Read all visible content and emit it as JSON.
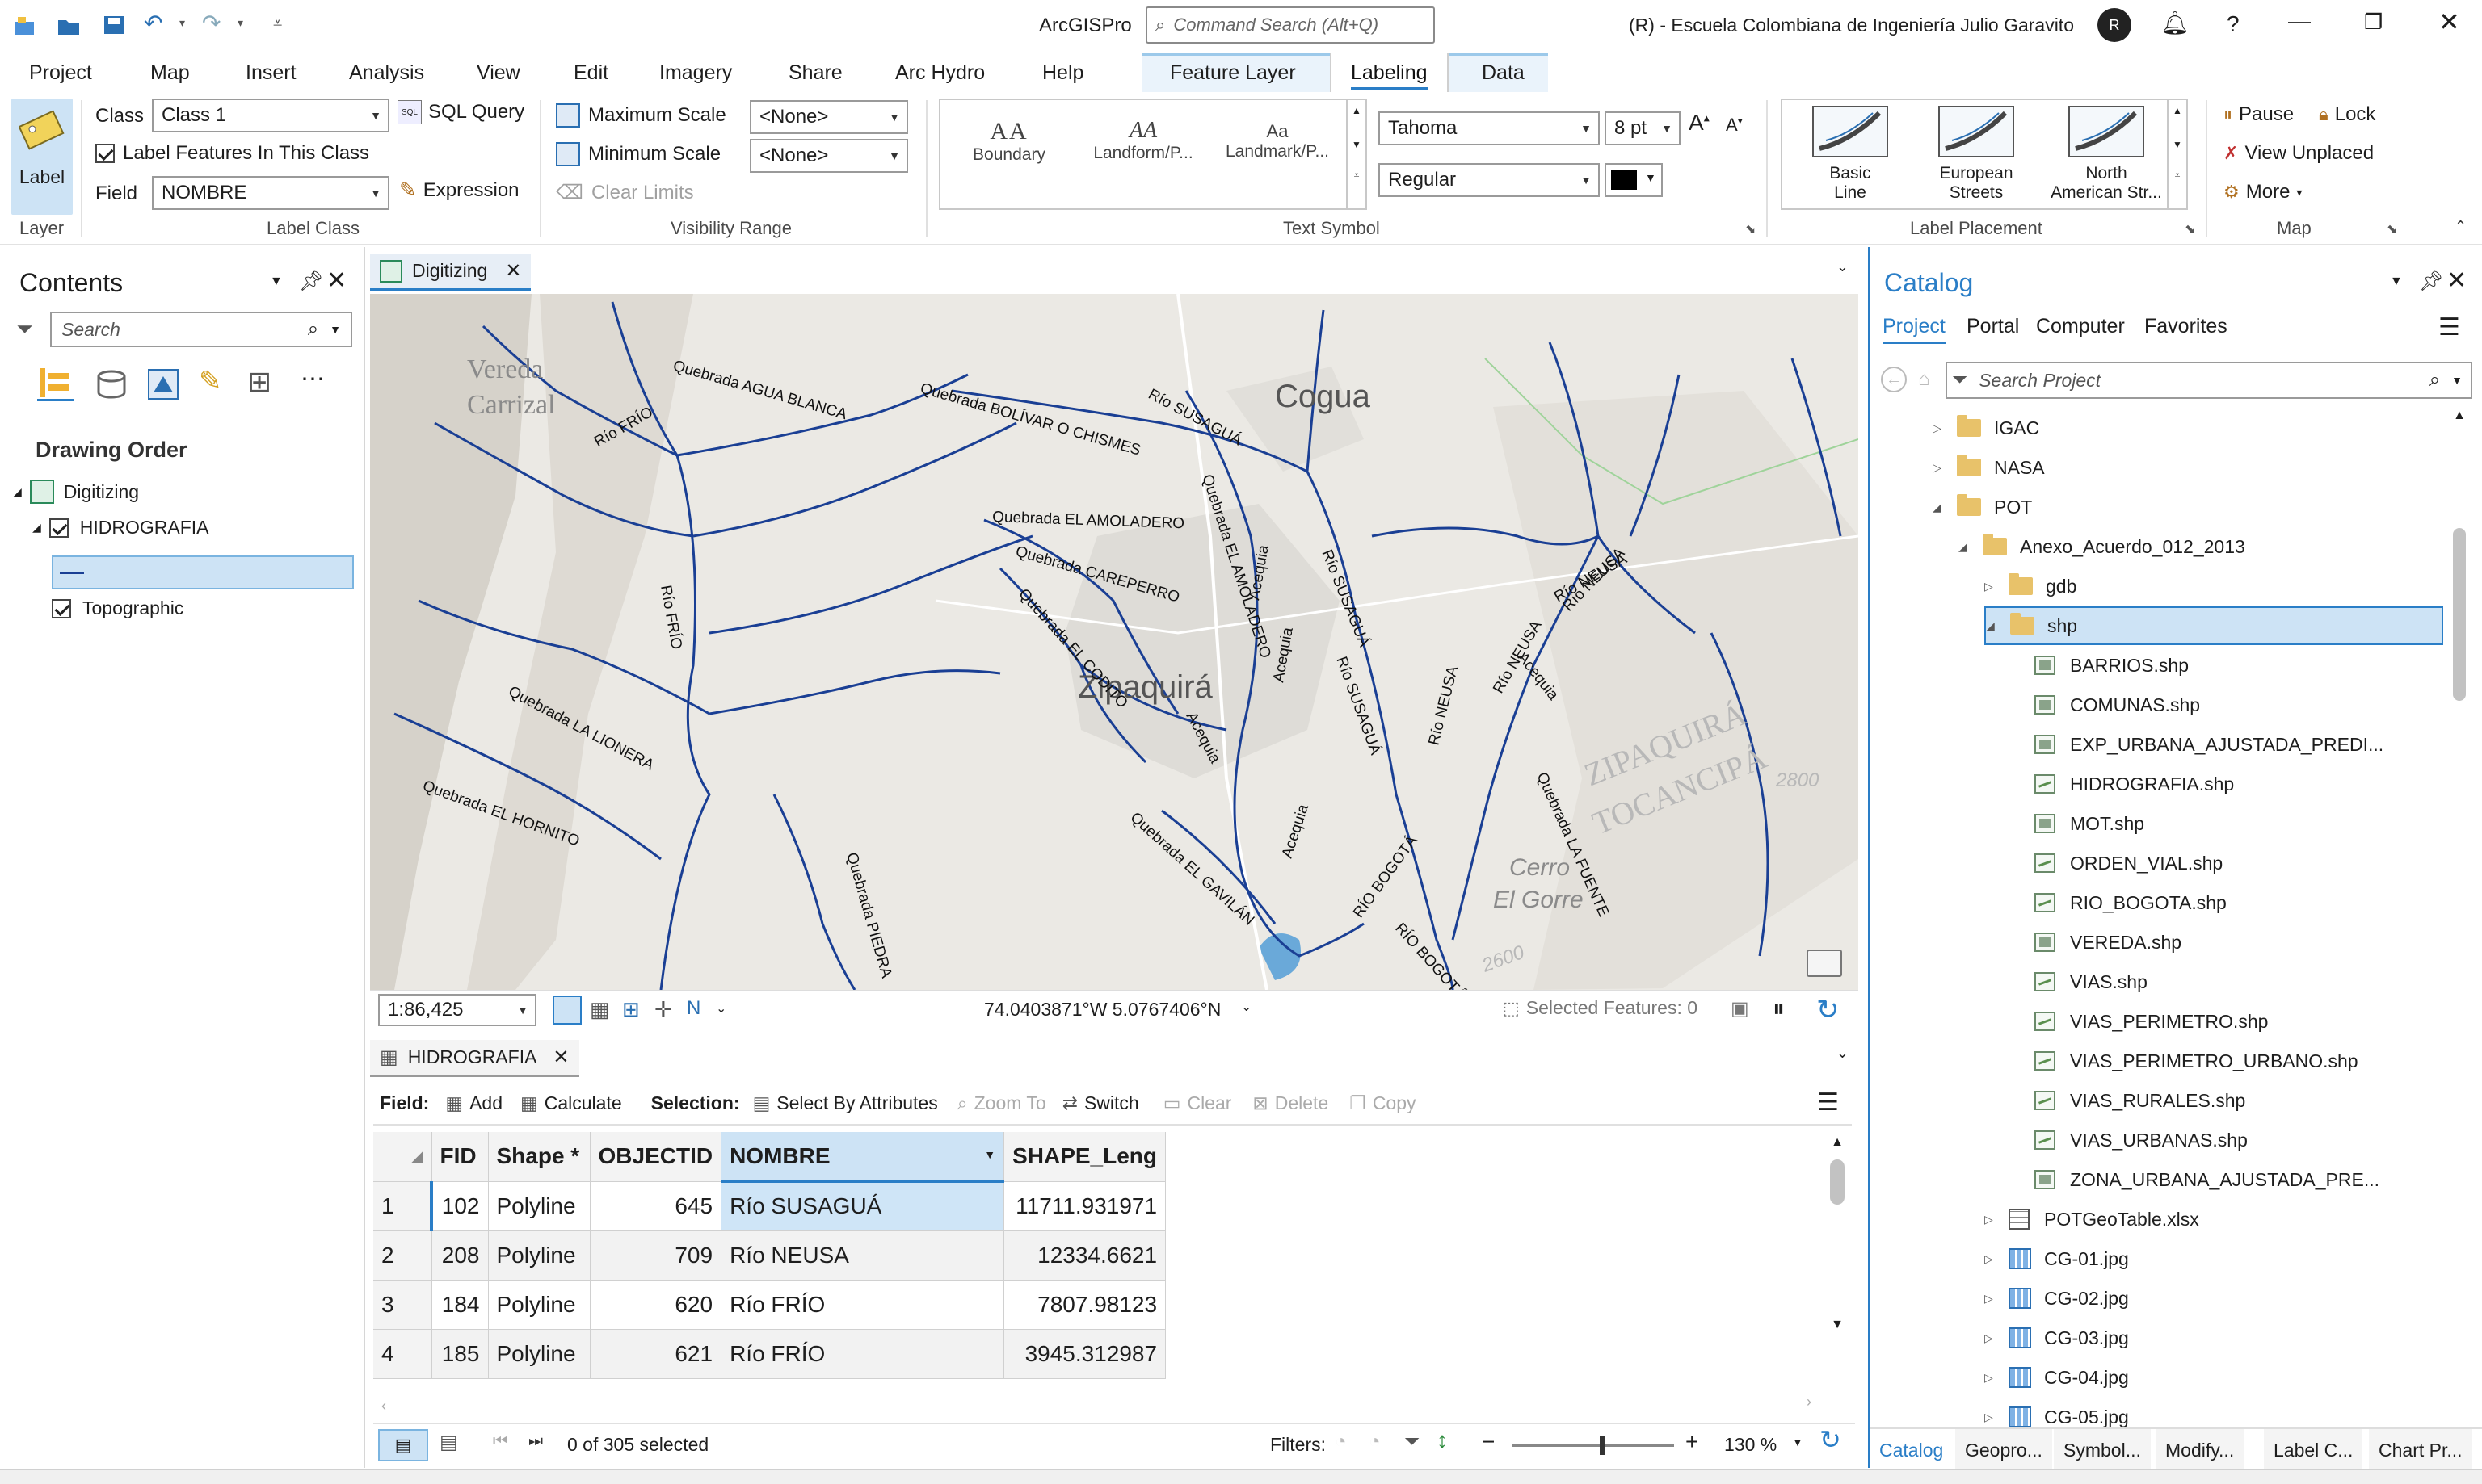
{
  "app": {
    "title": "ArcGISPro",
    "command_search_placeholder": "Command Search (Alt+Q)",
    "user_org": "(R) - Escuela Colombiana de Ingeniería Julio Garavito",
    "user_initial": "R"
  },
  "menu": {
    "tabs": [
      "Project",
      "Map",
      "Insert",
      "Analysis",
      "View",
      "Edit",
      "Imagery",
      "Share",
      "Arc Hydro",
      "Help"
    ],
    "context_tabs": [
      "Feature Layer",
      "Labeling",
      "Data"
    ],
    "active_context_tab": "Labeling"
  },
  "ribbon": {
    "layer_group": {
      "button": "Label",
      "label": "Layer"
    },
    "label_class": {
      "class_label": "Class",
      "class_value": "Class 1",
      "sql_query": "SQL Query",
      "label_features": "Label Features In This Class",
      "field_label": "Field",
      "field_value": "NOMBRE",
      "expression": "Expression",
      "group_label": "Label Class"
    },
    "visibility": {
      "max_scale": "Maximum Scale",
      "max_value": "<None>",
      "min_scale": "Minimum Scale",
      "min_value": "<None>",
      "clear_limits": "Clear Limits",
      "group_label": "Visibility Range"
    },
    "text_symbol": {
      "gallery": [
        {
          "preview": "AA",
          "label": "Boundary"
        },
        {
          "preview": "AA",
          "label": "Landform/P..."
        },
        {
          "preview": "Aa",
          "label": "Landmark/P..."
        }
      ],
      "font": "Tahoma",
      "size": "8 pt",
      "style": "Regular",
      "grow": "A",
      "shrink": "A",
      "color": "#000000",
      "group_label": "Text Symbol"
    },
    "placement": {
      "items": [
        {
          "line1": "Basic",
          "line2": "Line"
        },
        {
          "line1": "European",
          "line2": "Streets"
        },
        {
          "line1": "North",
          "line2": "American Str..."
        }
      ],
      "group_label": "Label Placement"
    },
    "map_group": {
      "pause": "Pause",
      "lock": "Lock",
      "view_unplaced": "View Unplaced",
      "more": "More",
      "group_label": "Map"
    }
  },
  "contents": {
    "title": "Contents",
    "search_placeholder": "Search",
    "drawing_order": "Drawing Order",
    "map_name": "Digitizing",
    "layers": [
      {
        "name": "HIDROGRAFIA",
        "checked": true
      },
      {
        "name": "Topographic",
        "checked": true
      }
    ]
  },
  "mapview": {
    "tab": "Digitizing",
    "labels": {
      "towns": [
        "Cogua",
        "Zipaquirá",
        "Vereda",
        "Carrizal",
        "Cerro",
        "El Gorre",
        "ZIPAQUIRÁ",
        "TOCANCIPÁ",
        "2800",
        "2600"
      ],
      "rivers": [
        "Quebrada AGUA BLANCA",
        "Río FRÍO",
        "Quebrada BOLÍVAR O CHISMES",
        "Río SUSAGUÁ",
        "Quebrada EL AMOLADERO",
        "Quebrada EL AMOLADERO",
        "Acequia",
        "Río SUSAGUÁ",
        "Quebrada CAREPERRO",
        "Quebrada EL CODITO",
        "Acequia",
        "Río FRÍO",
        "Río NEUSA",
        "Río NEUSA",
        "Río NEUSA",
        "Acequia",
        "Río NEUSA",
        "Río SUSAGUÁ",
        "Quebrada LA LIONERA",
        "Quebrada EL HORNITO",
        "Acequia",
        "Quebrada EL GAVILÁN",
        "Acequia",
        "RÍO BOGOTÁ",
        "RÍO BOGOTÁ",
        "Quebrada LA FUENTE",
        "Quebrada PIEDRA"
      ]
    },
    "scale": "1:86,425",
    "coordinates": "74.0403871°W 5.0767406°N",
    "selected_features": "Selected Features: 0"
  },
  "table": {
    "tab": "HIDROGRAFIA",
    "toolbar": {
      "field": "Field:",
      "add": "Add",
      "calculate": "Calculate",
      "selection": "Selection:",
      "select_by_attr": "Select By Attributes",
      "zoom_to": "Zoom To",
      "switch": "Switch",
      "clear": "Clear",
      "delete": "Delete",
      "copy": "Copy"
    },
    "columns": [
      "FID",
      "Shape *",
      "OBJECTID",
      "NOMBRE",
      "SHAPE_Leng"
    ],
    "rows": [
      {
        "n": "1",
        "fid": "102",
        "shape": "Polyline",
        "oid": "645",
        "nombre": "Río SUSAGUÁ",
        "len": "11711.931971"
      },
      {
        "n": "2",
        "fid": "208",
        "shape": "Polyline",
        "oid": "709",
        "nombre": "Río NEUSA",
        "len": "12334.6621"
      },
      {
        "n": "3",
        "fid": "184",
        "shape": "Polyline",
        "oid": "620",
        "nombre": "Río FRÍO",
        "len": "7807.98123"
      },
      {
        "n": "4",
        "fid": "185",
        "shape": "Polyline",
        "oid": "621",
        "nombre": "Río FRÍO",
        "len": "3945.312987"
      }
    ],
    "status": "0 of 305 selected",
    "filters": "Filters:",
    "zoom": "130 %"
  },
  "catalog": {
    "title": "Catalog",
    "tabs": [
      "Project",
      "Portal",
      "Computer",
      "Favorites"
    ],
    "search_placeholder": "Search Project",
    "tree": [
      {
        "label": "IGAC",
        "type": "folder",
        "indent": 0,
        "exp": "collapsed"
      },
      {
        "label": "NASA",
        "type": "folder",
        "indent": 0,
        "exp": "collapsed"
      },
      {
        "label": "POT",
        "type": "folder",
        "indent": 0,
        "exp": "expanded"
      },
      {
        "label": "Anexo_Acuerdo_012_2013",
        "type": "folder",
        "indent": 1,
        "exp": "expanded"
      },
      {
        "label": "gdb",
        "type": "folder",
        "indent": 2,
        "exp": "collapsed"
      },
      {
        "label": "shp",
        "type": "folder",
        "indent": 2,
        "exp": "expanded",
        "selected": true
      },
      {
        "label": "BARRIOS.shp",
        "type": "poly",
        "indent": 3
      },
      {
        "label": "COMUNAS.shp",
        "type": "poly",
        "indent": 3
      },
      {
        "label": "EXP_URBANA_AJUSTADA_PREDI...",
        "type": "poly",
        "indent": 3
      },
      {
        "label": "HIDROGRAFIA.shp",
        "type": "line",
        "indent": 3
      },
      {
        "label": "MOT.shp",
        "type": "poly",
        "indent": 3
      },
      {
        "label": "ORDEN_VIAL.shp",
        "type": "line",
        "indent": 3
      },
      {
        "label": "RIO_BOGOTA.shp",
        "type": "line",
        "indent": 3
      },
      {
        "label": "VEREDA.shp",
        "type": "poly",
        "indent": 3
      },
      {
        "label": "VIAS.shp",
        "type": "line",
        "indent": 3
      },
      {
        "label": "VIAS_PERIMETRO.shp",
        "type": "line",
        "indent": 3
      },
      {
        "label": "VIAS_PERIMETRO_URBANO.shp",
        "type": "line",
        "indent": 3
      },
      {
        "label": "VIAS_RURALES.shp",
        "type": "line",
        "indent": 3
      },
      {
        "label": "VIAS_URBANAS.shp",
        "type": "line",
        "indent": 3
      },
      {
        "label": "ZONA_URBANA_AJUSTADA_PRE...",
        "type": "poly",
        "indent": 3
      },
      {
        "label": "POTGeoTable.xlsx",
        "type": "xlsx",
        "indent": 2,
        "exp": "collapsed"
      },
      {
        "label": "CG-01.jpg",
        "type": "jpg",
        "indent": 2,
        "exp": "collapsed"
      },
      {
        "label": "CG-02.jpg",
        "type": "jpg",
        "indent": 2,
        "exp": "collapsed"
      },
      {
        "label": "CG-03.jpg",
        "type": "jpg",
        "indent": 2,
        "exp": "collapsed"
      },
      {
        "label": "CG-04.jpg",
        "type": "jpg",
        "indent": 2,
        "exp": "collapsed"
      },
      {
        "label": "CG-05.jpg",
        "type": "jpg",
        "indent": 2,
        "exp": "collapsed"
      }
    ],
    "bottom_tabs": [
      "Catalog",
      "Geopro...",
      "Symbol...",
      "Modify...",
      "Label C...",
      "Chart Pr..."
    ]
  },
  "colors": {
    "accent": "#2a7ec7",
    "selection": "#cde3f5",
    "river": "#1a3f94",
    "table_selected": "#cfe5f7"
  }
}
